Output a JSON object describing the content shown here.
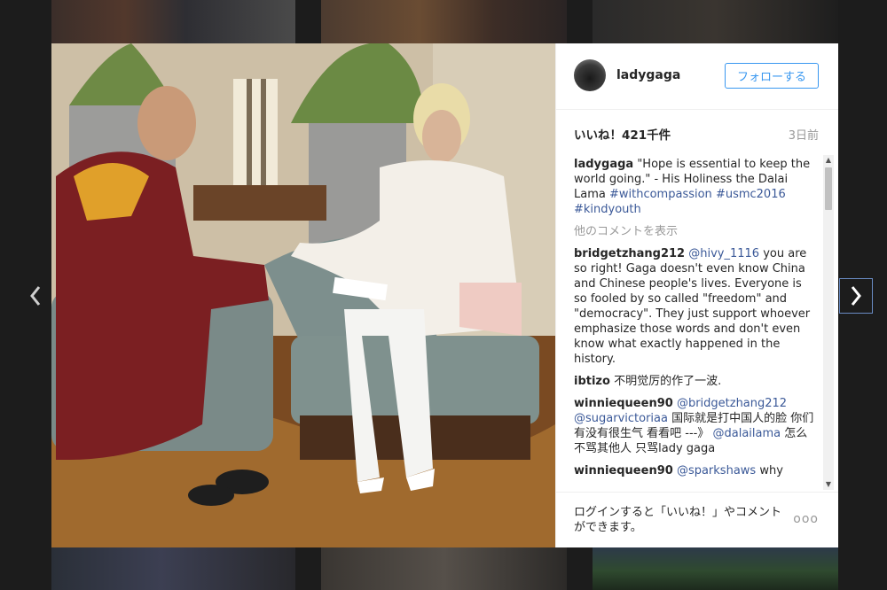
{
  "post": {
    "username": "ladygaga",
    "follow_label": "フォローする",
    "likes_label": "いいね！421千件",
    "time_ago": "3日前",
    "caption": {
      "user": "ladygaga",
      "text_part1": "\"Hope is essential to keep the world going.\" - His Holiness the Dalai Lama ",
      "hashtag1": "#withcompassion",
      "hashtag2": "#usmc2016",
      "hashtag3": "#kindyouth"
    },
    "more_comments_label": "他のコメントを表示",
    "comments": [
      {
        "user": "bridgetzhang212",
        "mention": "@hivy_1116",
        "text": " you are so right! Gaga doesn't even know China and Chinese people's lives. Everyone is so fooled by so called \"freedom\" and \"democracy\". They just support whoever emphasize those words and don't even know what exactly happened in the history."
      },
      {
        "user": "ibtizo",
        "text": " 不明觉厉的作了一波."
      },
      {
        "user": "winniequeen90",
        "mention1": "@bridgetzhang212",
        "mention2": "@sugarvictoriaa",
        "text1": " 国际就是打中国人的脸 你们有没有很生气 看看吧 ---》",
        "mention3": "@dalailama",
        "text2": " 怎么不骂其他人 只骂lady gaga"
      },
      {
        "user": "winniequeen90",
        "mention": "@sparkshaws",
        "text": " why"
      }
    ],
    "login_prompt": "ログインすると「いいね！」やコメントができます。",
    "more_options": "ooo"
  },
  "icons": {
    "prev": "chevron-left-icon",
    "next": "chevron-right-icon",
    "scroll_up": "▲",
    "scroll_down": "▼"
  }
}
